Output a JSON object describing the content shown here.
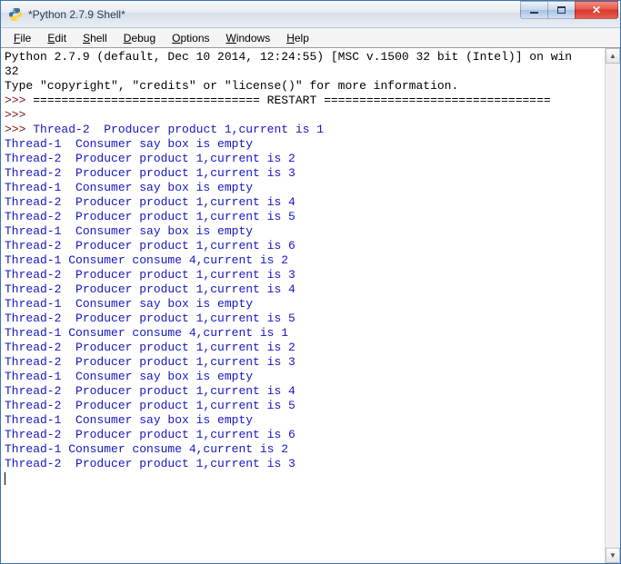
{
  "window": {
    "title": "*Python 2.7.9 Shell*"
  },
  "menu": {
    "file": "File",
    "edit": "Edit",
    "shell": "Shell",
    "debug": "Debug",
    "options": "Options",
    "windows": "Windows",
    "help": "Help"
  },
  "console": {
    "banner1": "Python 2.7.9 (default, Dec 10 2014, 12:24:55) [MSC v.1500 32 bit (Intel)] on win",
    "banner2": "32",
    "banner3": "Type \"copyright\", \"credits\" or \"license()\" for more information.",
    "prompt": ">>> ",
    "restart": "================================ RESTART ================================",
    "lines": [
      "Thread-2  Producer product 1,current is 1",
      "Thread-1  Consumer say box is empty",
      "Thread-2  Producer product 1,current is 2",
      "Thread-2  Producer product 1,current is 3",
      "Thread-1  Consumer say box is empty",
      "Thread-2  Producer product 1,current is 4",
      "Thread-2  Producer product 1,current is 5",
      "Thread-1  Consumer say box is empty",
      "Thread-2  Producer product 1,current is 6",
      "Thread-1 Consumer consume 4,current is 2",
      "Thread-2  Producer product 1,current is 3",
      "Thread-2  Producer product 1,current is 4",
      "Thread-1  Consumer say box is empty",
      "Thread-2  Producer product 1,current is 5",
      "Thread-1 Consumer consume 4,current is 1",
      "Thread-2  Producer product 1,current is 2",
      "Thread-2  Producer product 1,current is 3",
      "Thread-1  Consumer say box is empty",
      "Thread-2  Producer product 1,current is 4",
      "Thread-2  Producer product 1,current is 5",
      "Thread-1  Consumer say box is empty",
      "Thread-2  Producer product 1,current is 6",
      "Thread-1 Consumer consume 4,current is 2",
      "Thread-2  Producer product 1,current is 3"
    ]
  }
}
